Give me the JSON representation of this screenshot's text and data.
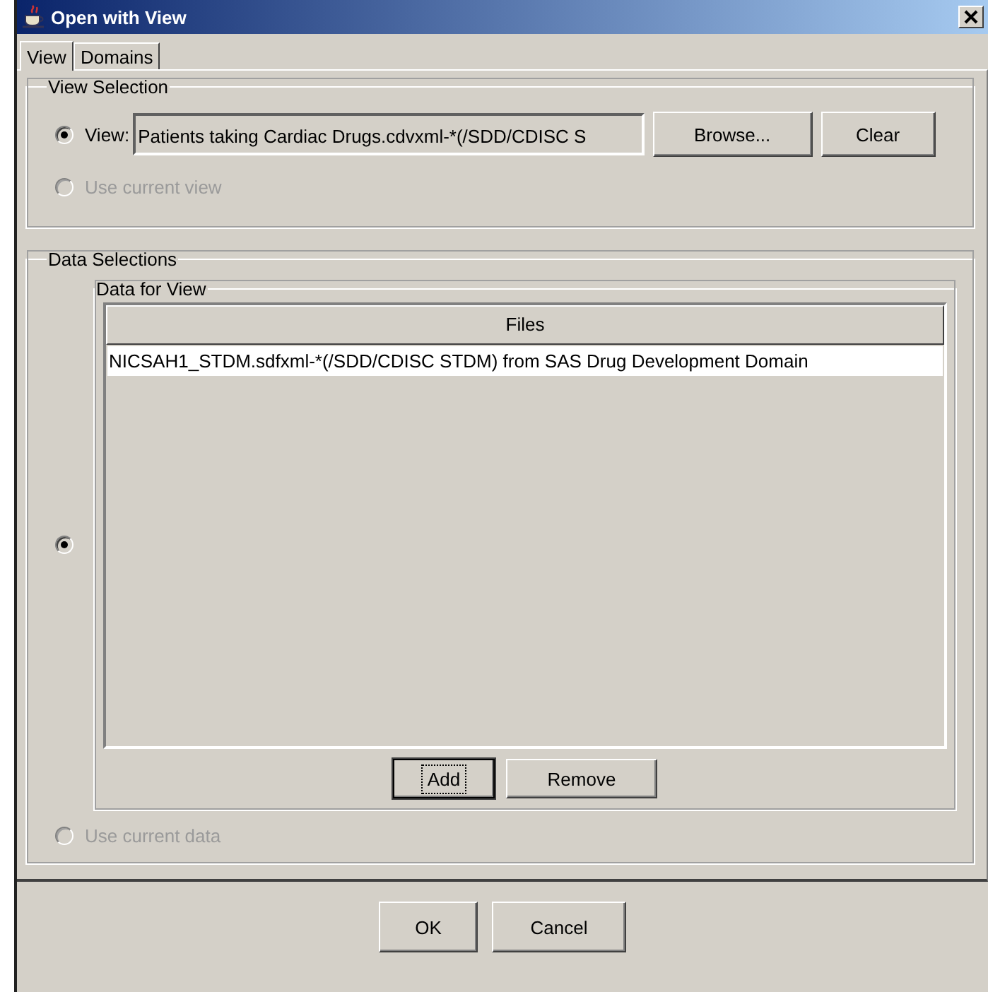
{
  "window": {
    "title": "Open with View"
  },
  "tabs": [
    {
      "label": "View",
      "selected": true
    },
    {
      "label": "Domains",
      "selected": false
    }
  ],
  "view_selection": {
    "title": "View Selection",
    "options": [
      {
        "kind": "field",
        "label": "View:",
        "selected": true,
        "disabled": false,
        "value": "Patients taking Cardiac Drugs.cdvxml-*(/SDD/CDISC S",
        "buttons": [
          {
            "label": "Browse...",
            "focused": false
          },
          {
            "label": "Clear",
            "focused": false
          }
        ]
      },
      {
        "kind": "plain",
        "label": "Use current view",
        "selected": false,
        "disabled": true
      }
    ]
  },
  "data_selections": {
    "title": "Data Selections",
    "options": [
      {
        "kind": "group",
        "selected": true,
        "disabled": false,
        "group": {
          "title": "Data for View",
          "table": {
            "columns": [
              "Files"
            ],
            "rows": [
              {
                "cells": [
                  "NICSAH1_STDM.sdfxml-*(/SDD/CDISC STDM) from SAS Drug Development Domain"
                ],
                "selected": false
              }
            ]
          },
          "buttons": [
            {
              "label": "Add",
              "focused": true
            },
            {
              "label": "Remove",
              "focused": false
            }
          ]
        }
      },
      {
        "kind": "plain",
        "label": "Use current data",
        "selected": false,
        "disabled": true
      }
    ]
  },
  "buttons": [
    {
      "label": "OK",
      "focused": false
    },
    {
      "label": "Cancel",
      "focused": false
    }
  ]
}
